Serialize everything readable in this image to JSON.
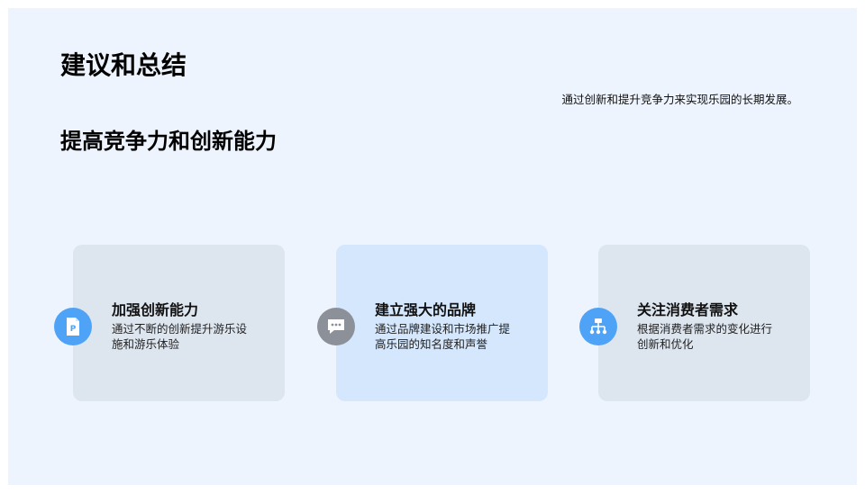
{
  "slide": {
    "title": "建议和总结",
    "summary": "通过创新和提升竞争力来实现乐园的长期发展。",
    "subtitle": "提高竞争力和创新能力"
  },
  "cards": [
    {
      "title": "加强创新能力",
      "description": "通过不断的创新提升游乐设施和游乐体验",
      "icon": "document-p-icon",
      "icon_color": "#4ea3f7"
    },
    {
      "title": "建立强大的品牌",
      "description": "通过品牌建设和市场推广提高乐园的知名度和声誉",
      "icon": "chat-bubble-icon",
      "icon_color": "#8c9099"
    },
    {
      "title": "关注消费者需求",
      "description": "根据消费者需求的变化进行创新和优化",
      "icon": "hierarchy-icon",
      "icon_color": "#4ea3f7"
    }
  ],
  "colors": {
    "background": "#edf4fe",
    "card": "#dde5ef",
    "card_highlight": "#d4e7fd"
  }
}
